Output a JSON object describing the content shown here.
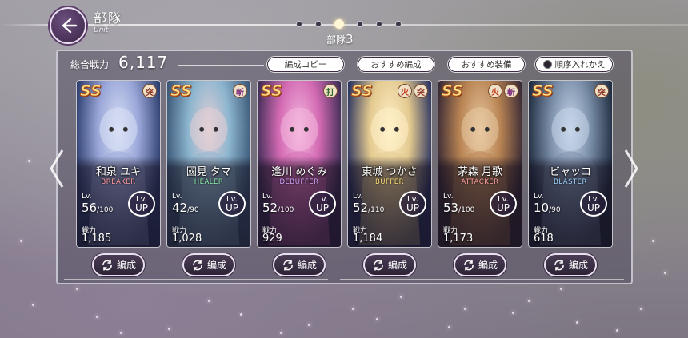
{
  "header": {
    "title": "部隊",
    "subtitle": "Unit",
    "unit_prefix": "部隊",
    "unit_number": "3"
  },
  "pagination": {
    "total": 6,
    "active_index": 2
  },
  "summary": {
    "power_label": "総合戦力",
    "power_value": "6,117"
  },
  "actions": {
    "copy": "編成コピー",
    "recommend_form": "おすすめ編成",
    "recommend_equip": "おすすめ装備",
    "reorder": "順序入れかえ"
  },
  "labels": {
    "lv": "Lv.",
    "power": "戦力",
    "lvup_top": "Lv.",
    "lvup_bottom": "UP",
    "form_btn": "編成",
    "rank": "SS"
  },
  "characters": [
    {
      "name": "和泉 ユキ",
      "role": "BREAKER",
      "role_color": "#ff9aa0",
      "level": "56",
      "max_level": "/100",
      "power": "1,185",
      "badges": [
        "突"
      ],
      "palette": [
        "#2c3e6e",
        "#9aa7d8",
        "#d9e0f5"
      ]
    },
    {
      "name": "國見 タマ",
      "role": "HEALER",
      "role_color": "#8ff0b0",
      "level": "42",
      "max_level": "/90",
      "power": "1,028",
      "badges": [
        "斬"
      ],
      "palette": [
        "#3a5677",
        "#8db6cf",
        "#e5cfd6"
      ]
    },
    {
      "name": "逢川 めぐみ",
      "role": "DEBUFFER",
      "role_color": "#d6a6ff",
      "level": "52",
      "max_level": "/100",
      "power": "929",
      "badges": [
        "打"
      ],
      "palette": [
        "#3d2c54",
        "#d36ab3",
        "#f4b8de"
      ]
    },
    {
      "name": "東城 つかさ",
      "role": "BUFFER",
      "role_color": "#ffe07a",
      "level": "52",
      "max_level": "/110",
      "power": "1,184",
      "badges": [
        "火",
        "突"
      ],
      "palette": [
        "#2a3360",
        "#e3c98f",
        "#fff1c9"
      ]
    },
    {
      "name": "茅森 月歌",
      "role": "ATTACKER",
      "role_color": "#ffa0a0",
      "level": "53",
      "max_level": "/100",
      "power": "1,173",
      "badges": [
        "火",
        "斬"
      ],
      "palette": [
        "#3a2a35",
        "#b98453",
        "#e8c9a2"
      ]
    },
    {
      "name": "ビャッコ",
      "role": "BLASTER",
      "role_color": "#9fd4ff",
      "level": "10",
      "max_level": "/90",
      "power": "618",
      "badges": [
        "突"
      ],
      "palette": [
        "#1e2a3e",
        "#7a8ea8",
        "#c7d6ea"
      ]
    }
  ]
}
